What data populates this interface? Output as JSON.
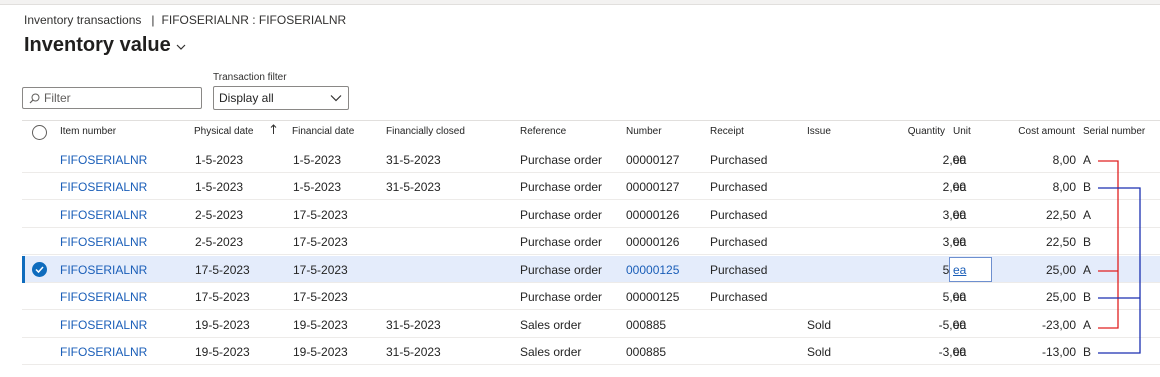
{
  "breadcrumb": {
    "module": "Inventory transactions",
    "separator": "|",
    "context": "FIFOSERIALNR : FIFOSERIALNR"
  },
  "page": {
    "title": "Inventory value"
  },
  "filters": {
    "search_placeholder": "Filter",
    "transaction_filter_label": "Transaction filter",
    "transaction_filter_value": "Display all"
  },
  "columns": {
    "item_number": "Item number",
    "physical_date": "Physical date",
    "financial_date": "Financial date",
    "financially_closed": "Financially closed",
    "reference": "Reference",
    "number": "Number",
    "receipt": "Receipt",
    "issue": "Issue",
    "quantity": "Quantity",
    "unit": "Unit",
    "cost_amount": "Cost amount",
    "serial_number": "Serial number"
  },
  "rows": [
    {
      "item": "FIFOSERIALNR",
      "physical_date": "1-5-2023",
      "financial_date": "1-5-2023",
      "financially_closed": "31-5-2023",
      "reference": "Purchase order",
      "number": "00000127",
      "receipt": "Purchased",
      "issue": "",
      "quantity": "2,00",
      "unit": "ea",
      "cost_amount": "8,00",
      "serial": "A",
      "selected": false
    },
    {
      "item": "FIFOSERIALNR",
      "physical_date": "1-5-2023",
      "financial_date": "1-5-2023",
      "financially_closed": "31-5-2023",
      "reference": "Purchase order",
      "number": "00000127",
      "receipt": "Purchased",
      "issue": "",
      "quantity": "2,00",
      "unit": "ea",
      "cost_amount": "8,00",
      "serial": "B",
      "selected": false
    },
    {
      "item": "FIFOSERIALNR",
      "physical_date": "2-5-2023",
      "financial_date": "17-5-2023",
      "financially_closed": "",
      "reference": "Purchase order",
      "number": "00000126",
      "receipt": "Purchased",
      "issue": "",
      "quantity": "3,00",
      "unit": "ea",
      "cost_amount": "22,50",
      "serial": "A",
      "selected": false
    },
    {
      "item": "FIFOSERIALNR",
      "physical_date": "2-5-2023",
      "financial_date": "17-5-2023",
      "financially_closed": "",
      "reference": "Purchase order",
      "number": "00000126",
      "receipt": "Purchased",
      "issue": "",
      "quantity": "3,00",
      "unit": "ea",
      "cost_amount": "22,50",
      "serial": "B",
      "selected": false
    },
    {
      "item": "FIFOSERIALNR",
      "physical_date": "17-5-2023",
      "financial_date": "17-5-2023",
      "financially_closed": "",
      "reference": "Purchase order",
      "number": "00000125",
      "receipt": "Purchased",
      "issue": "",
      "quantity": "5,00",
      "unit": "ea",
      "cost_amount": "25,00",
      "serial": "A",
      "selected": true
    },
    {
      "item": "FIFOSERIALNR",
      "physical_date": "17-5-2023",
      "financial_date": "17-5-2023",
      "financially_closed": "",
      "reference": "Purchase order",
      "number": "00000125",
      "receipt": "Purchased",
      "issue": "",
      "quantity": "5,00",
      "unit": "ea",
      "cost_amount": "25,00",
      "serial": "B",
      "selected": false
    },
    {
      "item": "FIFOSERIALNR",
      "physical_date": "19-5-2023",
      "financial_date": "19-5-2023",
      "financially_closed": "31-5-2023",
      "reference": "Sales order",
      "number": "000885",
      "receipt": "",
      "issue": "Sold",
      "quantity": "-5,00",
      "unit": "ea",
      "cost_amount": "-23,00",
      "serial": "A",
      "selected": false
    },
    {
      "item": "FIFOSERIALNR",
      "physical_date": "19-5-2023",
      "financial_date": "19-5-2023",
      "financially_closed": "31-5-2023",
      "reference": "Sales order",
      "number": "000885",
      "receipt": "",
      "issue": "Sold",
      "quantity": "-3,00",
      "unit": "ea",
      "cost_amount": "-13,00",
      "serial": "B",
      "selected": false
    }
  ],
  "colors": {
    "link": "#1a5eb8",
    "selected_row": "#e4ecfb",
    "accent": "#0f6cbd",
    "annotation_serial_a": "#e02020",
    "annotation_serial_b": "#1a2fb0"
  },
  "icons": {
    "search": "search-icon",
    "title_dropdown": "chevron-down-icon",
    "filter_dropdown": "chevron-down-icon",
    "sort": "sort-ascending-icon",
    "select_all": "select-all-circle-icon",
    "row_check": "checkmark-circle-icon"
  }
}
